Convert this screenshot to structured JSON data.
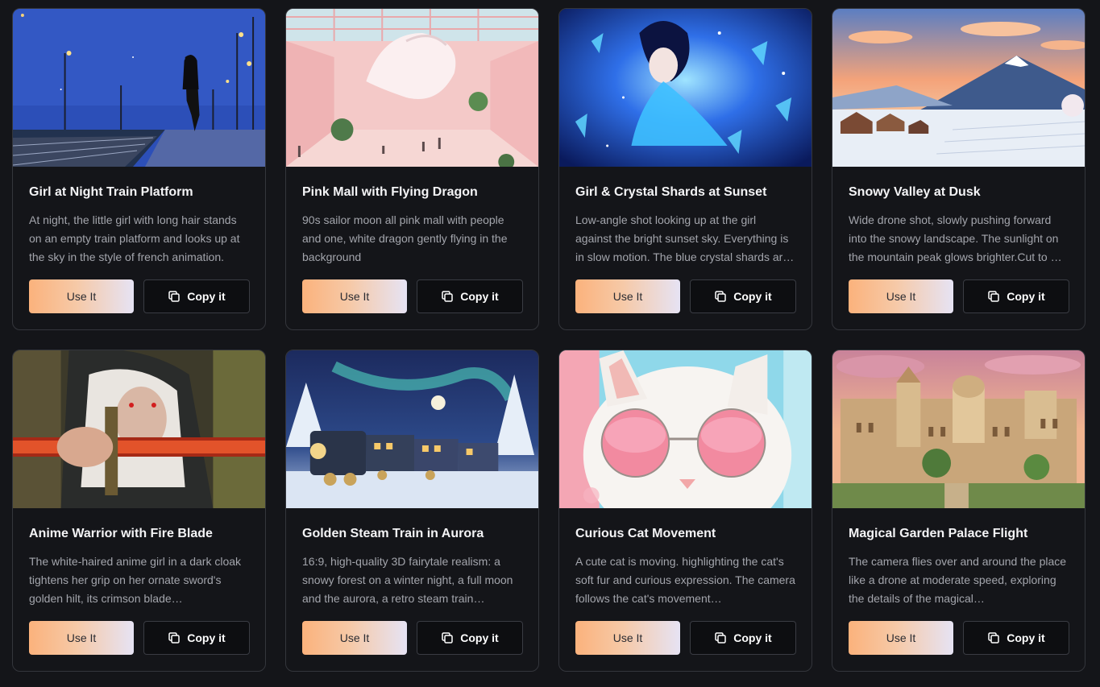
{
  "cards": [
    {
      "title": "Girl at Night Train Platform",
      "description": "At night, the little girl with long hair stands on an empty train platform and looks up at the sky in the style of french animation.",
      "use_label": "Use It",
      "copy_label": "Copy it"
    },
    {
      "title": "Pink Mall with Flying Dragon",
      "description": "90s sailor moon all pink mall with people and one, white dragon gently flying in the background",
      "use_label": "Use It",
      "copy_label": "Copy it"
    },
    {
      "title": "Girl & Crystal Shards at Sunset",
      "description": "Low-angle shot looking up at the girl against the bright sunset sky. Everything is in slow motion. The blue crystal shards ar…",
      "use_label": "Use It",
      "copy_label": "Copy it"
    },
    {
      "title": "Snowy Valley at Dusk",
      "description": "Wide drone shot, slowly pushing forward into the snowy landscape. The sunlight on the mountain peak glows brighter.Cut to …",
      "use_label": "Use It",
      "copy_label": "Copy it"
    },
    {
      "title": "Anime Warrior with Fire Blade",
      "description": "The white-haired anime girl in a dark cloak tightens her grip on her ornate sword's golden hilt, its crimson blade…",
      "use_label": "Use It",
      "copy_label": "Copy it"
    },
    {
      "title": "Golden Steam Train in Aurora",
      "description": "16:9, high-quality 3D fairytale realism: a snowy forest on a winter night, a full moon and the aurora, a retro steam train…",
      "use_label": "Use It",
      "copy_label": "Copy it"
    },
    {
      "title": "Curious Cat Movement",
      "description": "A cute cat is moving. highlighting the cat's soft fur and curious expression. The camera follows the cat's movement…",
      "use_label": "Use It",
      "copy_label": "Copy it"
    },
    {
      "title": "Magical Garden Palace Flight",
      "description": "The camera flies over and around the place like a drone at moderate speed, exploring the details of the magical…",
      "use_label": "Use It",
      "copy_label": "Copy it"
    }
  ],
  "icons": {
    "copy": "copy-icon"
  },
  "colors": {
    "background": "#141519",
    "use_button_gradient_start": "#fbb27c",
    "use_button_gradient_end": "#e6e3f4",
    "copy_button_bg": "#0d0e11"
  }
}
